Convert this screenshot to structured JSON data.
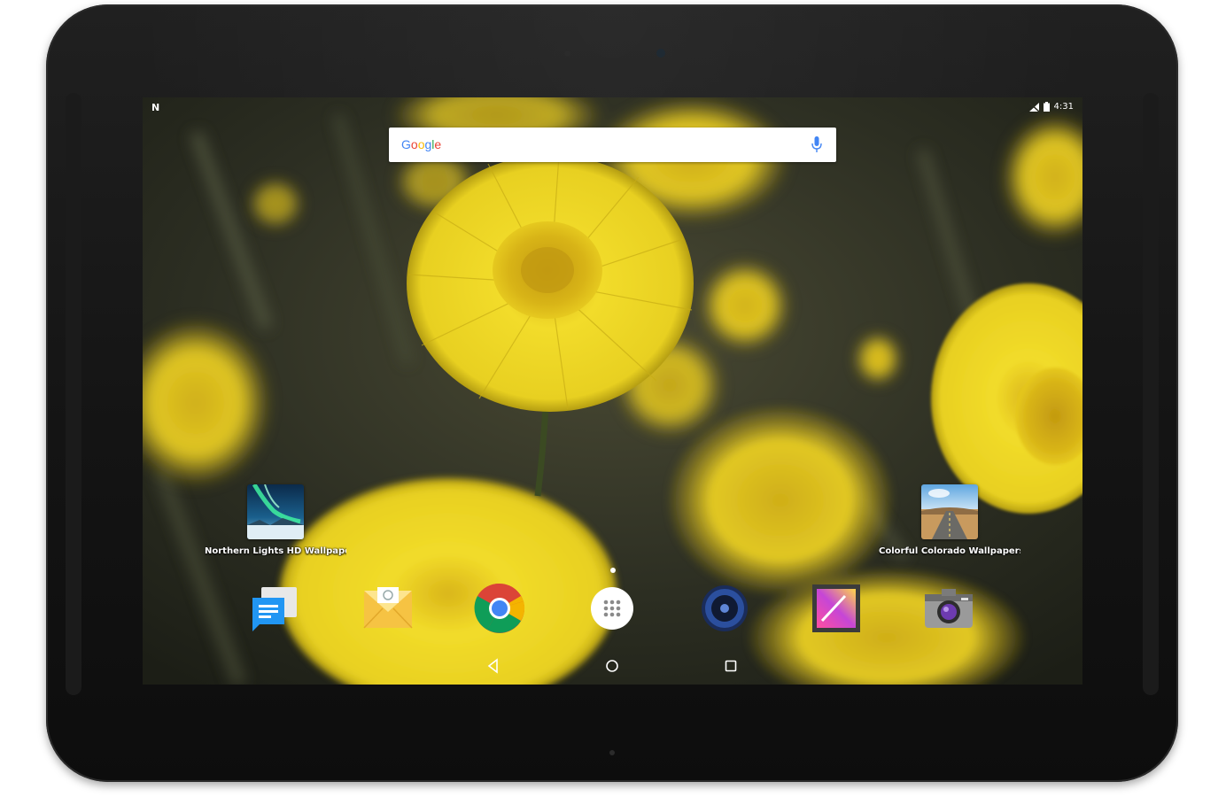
{
  "device": {
    "frame_color": "#151515",
    "screen_accent": "#e9d321"
  },
  "status_bar": {
    "left_icon": "notification-n-icon",
    "icons": [
      "no-signal-icon",
      "battery-icon"
    ],
    "time": "4:31"
  },
  "search": {
    "logo_text": "Google",
    "logo_colors": [
      "#4285f4",
      "#ea4335",
      "#fbbc05",
      "#4285f4",
      "#34a853",
      "#ea4335"
    ],
    "mic_icon": "mic-icon"
  },
  "home_icons": [
    {
      "label": "Northern Lights HD Wallpaper",
      "icon": "northern-lights-icon"
    },
    {
      "label": "Colorful Colorado Wallpapers",
      "icon": "colorado-road-icon"
    }
  ],
  "dock": [
    {
      "name": "messenger",
      "icon": "messenger-icon"
    },
    {
      "name": "email",
      "icon": "email-icon"
    },
    {
      "name": "chrome",
      "icon": "chrome-icon"
    },
    {
      "name": "app-drawer",
      "icon": "app-drawer-icon"
    },
    {
      "name": "music",
      "icon": "speaker-icon"
    },
    {
      "name": "gallery",
      "icon": "gallery-icon"
    },
    {
      "name": "camera",
      "icon": "camera-icon"
    }
  ],
  "navigation": [
    "back-icon",
    "home-icon",
    "recents-icon"
  ]
}
